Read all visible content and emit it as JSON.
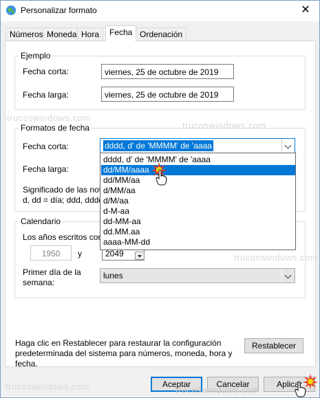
{
  "window": {
    "title": "Personalizar formato",
    "close_glyph": "✕"
  },
  "tabs": [
    {
      "label": "Números"
    },
    {
      "label": "Moneda"
    },
    {
      "label": "Hora"
    },
    {
      "label": "Fecha",
      "active": true
    },
    {
      "label": "Ordenación"
    }
  ],
  "example": {
    "group_label": "Ejemplo",
    "short_label": "Fecha corta:",
    "short_value": "viernes, 25 de octubre de 2019",
    "long_label": "Fecha larga:",
    "long_value": "viernes, 25 de octubre de 2019"
  },
  "formats": {
    "group_label": "Formatos de fecha",
    "short_label": "Fecha corta:",
    "short_selected": "dddd, d' de 'MMMM' de 'aaaa",
    "long_label": "Fecha larga:",
    "notation_line1": "Significado de las not",
    "notation_line2": "d, dd = día;  ddd, dddd",
    "dropdown_options": [
      "dddd, d' de 'MMMM' de 'aaaa",
      "dd/MM/aaaa",
      "dd/MM/aa",
      "d/MM/aa",
      "d/M/aa",
      "d-M-aa",
      "dd-MM-aa",
      "dd.MM.aa",
      "aaaa-MM-dd"
    ],
    "dropdown_highlighted_index": 1
  },
  "calendar": {
    "group_label": "Calendario",
    "years_label": "Los años escritos con",
    "year_from": "1950",
    "and_label": "y",
    "year_to": "2049",
    "first_day_label_line1": "Primer día de la",
    "first_day_label_line2": "semana:",
    "first_day_value": "lunes"
  },
  "restore": {
    "text_line1": "Haga clic en Restablecer para restaurar la configuración",
    "text_line2": "predeterminada del sistema para números, moneda, hora y",
    "text_line3": "fecha.",
    "button_label": "Restablecer"
  },
  "buttons": {
    "accept": "Aceptar",
    "cancel": "Cancelar",
    "apply": "Aplicar"
  },
  "watermark": "trucoswindows.com",
  "colors": {
    "selection": "#0078d7",
    "window_border": "#7a9cc8"
  }
}
